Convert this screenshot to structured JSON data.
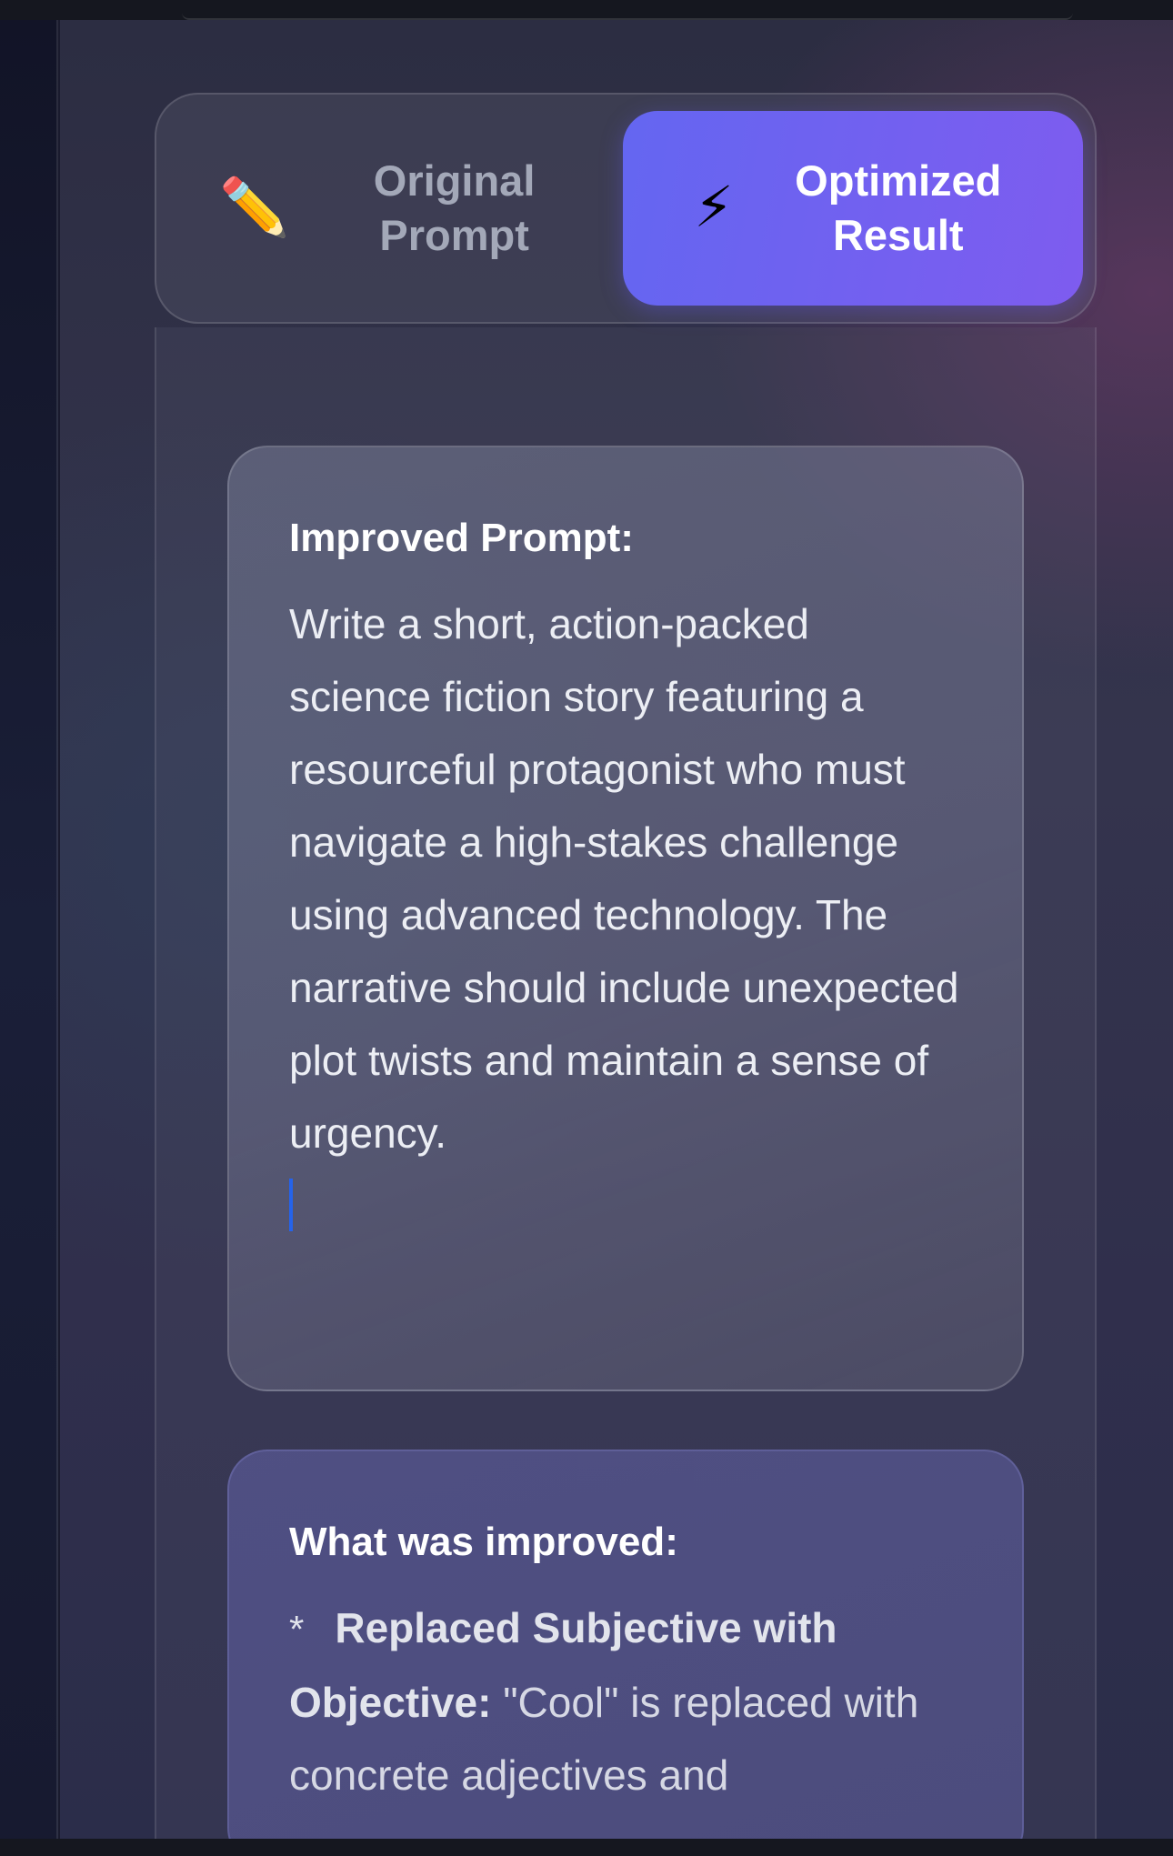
{
  "tabs": [
    {
      "label": "Original Prompt",
      "icon": "pencil-icon",
      "glyph": "✏️",
      "active": false
    },
    {
      "label": "Optimized Result",
      "icon": "lightning-icon",
      "glyph": "⚡",
      "active": true
    }
  ],
  "improved_card": {
    "heading": "Improved Prompt:",
    "body": "Write a short, action-packed science fiction story featuring a resourceful protagonist who must navigate a high-stakes challenge using advanced technology. The narrative should include unexpected plot twists and maintain a sense of urgency."
  },
  "what_card": {
    "heading": "What was improved:",
    "bullet_marker": "*",
    "bullet_bold": "Replaced Subjective with Objective:",
    "bullet_text": " \"Cool\" is replaced with concrete adjectives and"
  },
  "colors": {
    "accent_start": "#6466f1",
    "accent_end": "#7e5cef",
    "cursor": "#2563eb"
  }
}
